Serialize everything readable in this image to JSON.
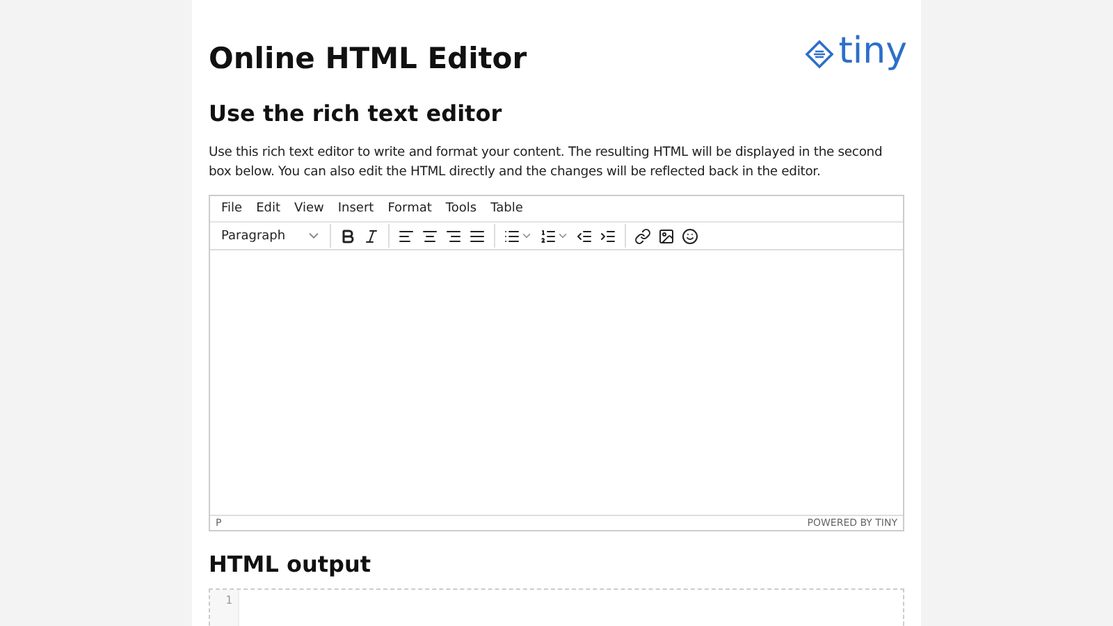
{
  "logo": {
    "text": "tiny"
  },
  "title": "Online HTML Editor",
  "editor_section": {
    "heading": "Use the rich text editor",
    "description": "Use this rich text editor to write and format your content. The resulting HTML will be displayed in the second box below. You can also edit the HTML directly and the changes will be reflected back in the editor."
  },
  "editor": {
    "menu": [
      "File",
      "Edit",
      "View",
      "Insert",
      "Format",
      "Tools",
      "Table"
    ],
    "toolbar": [
      [
        {
          "kind": "select",
          "label": "Paragraph"
        }
      ],
      [
        {
          "kind": "bold"
        },
        {
          "kind": "italic"
        }
      ],
      [
        {
          "kind": "align-left"
        },
        {
          "kind": "align-center"
        },
        {
          "kind": "align-right"
        },
        {
          "kind": "justify"
        }
      ],
      [
        {
          "kind": "bullet-list"
        },
        {
          "kind": "numbered-list"
        },
        {
          "kind": "outdent"
        },
        {
          "kind": "indent"
        }
      ],
      [
        {
          "kind": "link"
        },
        {
          "kind": "image"
        },
        {
          "kind": "emoji"
        }
      ]
    ],
    "status_path": "P",
    "branding": "POWERED BY TINY"
  },
  "output_section": {
    "heading": "HTML output",
    "line_numbers": [
      "1"
    ]
  }
}
